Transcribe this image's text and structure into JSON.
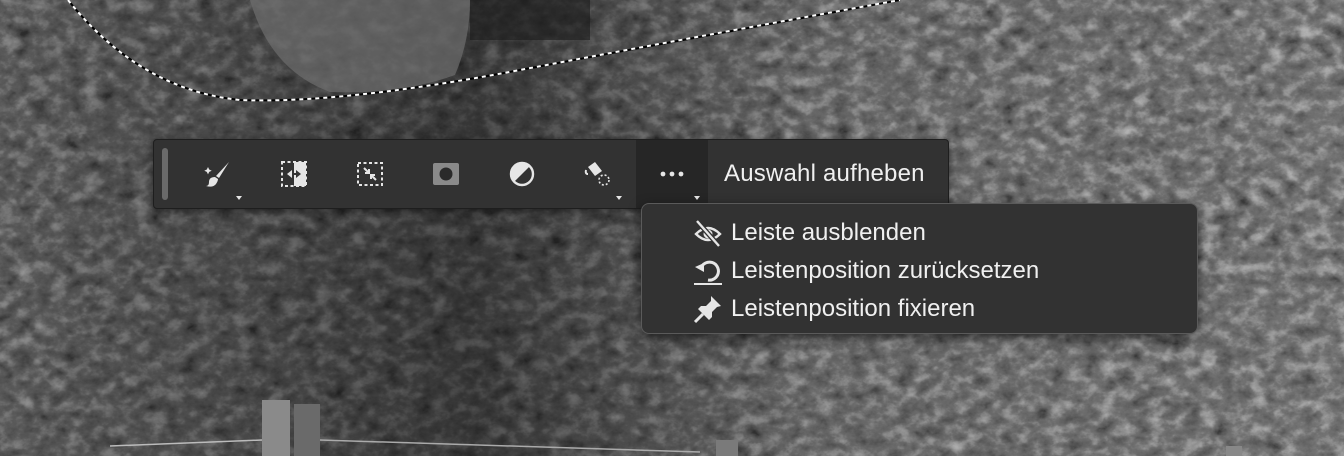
{
  "toolbar": {
    "tools": [
      {
        "icon": "brush-icon",
        "has_menu": true
      },
      {
        "icon": "select-subject-icon",
        "has_menu": false
      },
      {
        "icon": "transform-selection-icon",
        "has_menu": false
      },
      {
        "icon": "mask-icon",
        "has_menu": false
      },
      {
        "icon": "adjustment-layer-icon",
        "has_menu": false
      },
      {
        "icon": "fill-icon",
        "has_menu": true
      }
    ],
    "more_icon": "more-options-icon",
    "deselect_label": "Auswahl aufheben"
  },
  "menu": {
    "items": [
      {
        "label": "Leiste ausblenden",
        "icon": "hide-eye-icon"
      },
      {
        "label": "Leistenposition zurücksetzen",
        "icon": "reset-rotate-icon"
      },
      {
        "label": "Leistenposition fixieren",
        "icon": "pin-icon"
      }
    ]
  },
  "colors": {
    "panel": "#323232",
    "text": "#f0f0f0",
    "selection_marquee": "#ffffff"
  }
}
